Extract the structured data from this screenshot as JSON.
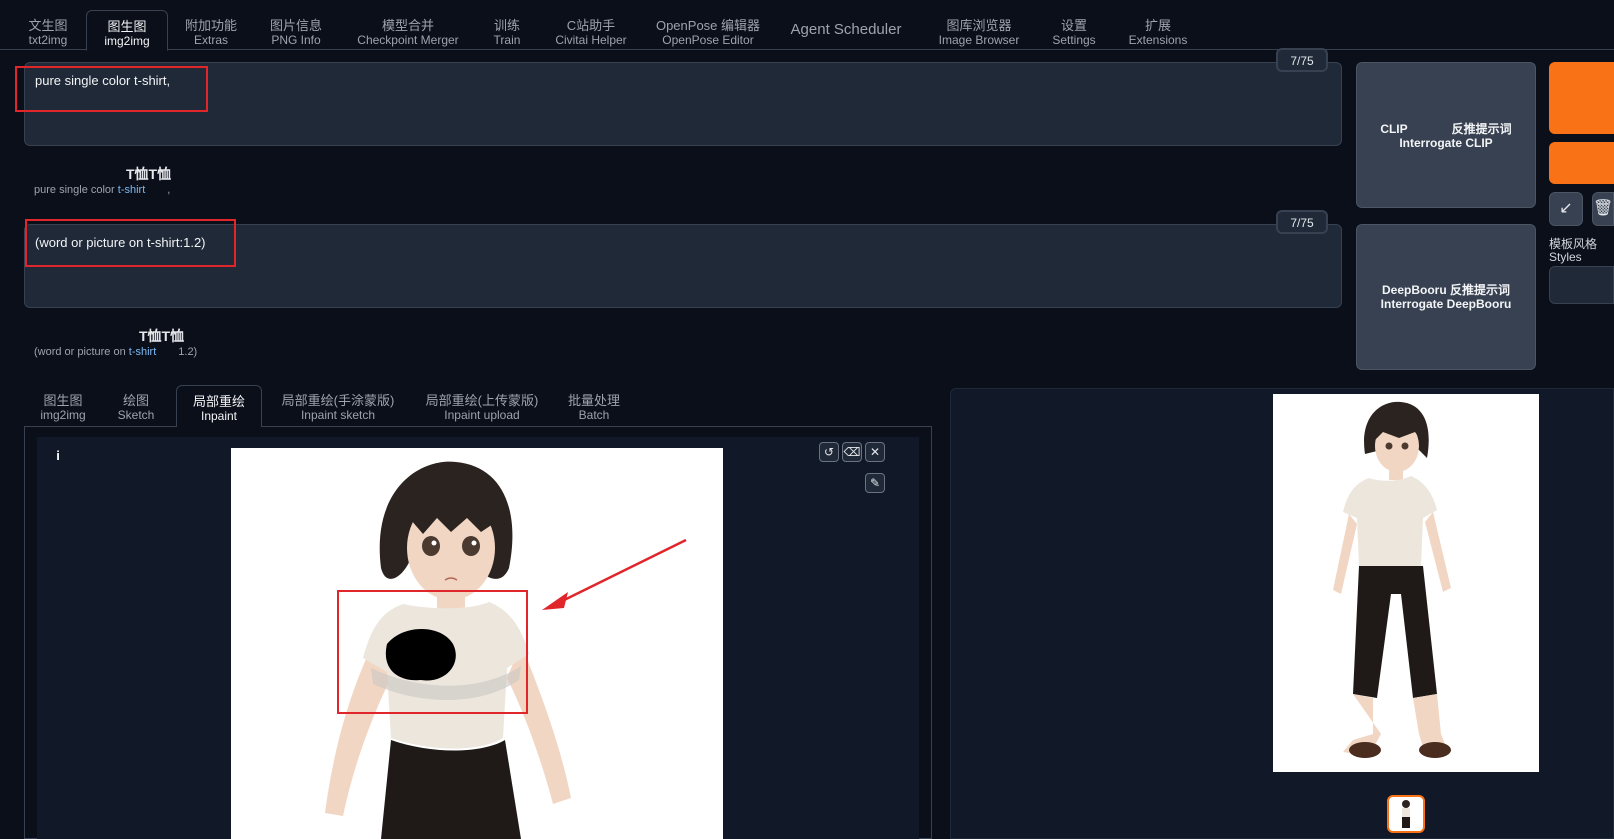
{
  "top_tabs": [
    {
      "zh": "文生图",
      "en": "txt2img"
    },
    {
      "zh": "图生图",
      "en": "img2img"
    },
    {
      "zh": "附加功能",
      "en": "Extras"
    },
    {
      "zh": "图片信息",
      "en": "PNG Info"
    },
    {
      "zh": "模型合并",
      "en": "Checkpoint Merger"
    },
    {
      "zh": "训练",
      "en": "Train"
    },
    {
      "zh": "C站助手",
      "en": "Civitai Helper"
    },
    {
      "zh": "OpenPose 编辑器",
      "en": "OpenPose Editor"
    },
    {
      "label": "Agent Scheduler"
    },
    {
      "zh": "图库浏览器",
      "en": "Image Browser"
    },
    {
      "zh": "设置",
      "en": "Settings"
    },
    {
      "zh": "扩展",
      "en": "Extensions"
    }
  ],
  "prompt": {
    "text": "pure single color t-shirt,",
    "counter": "7/75",
    "translation_title": "T恤T恤",
    "translation_pre": "pure single color ",
    "translation_hl": "t-shirt",
    "translation_post": ","
  },
  "negative_prompt": {
    "text": "(word or picture on t-shirt:1.2)",
    "counter": "7/75",
    "translation_title": "T恤T恤",
    "translation_pre": "(word or picture on ",
    "translation_hl": "t-shirt",
    "translation_post": "1.2)"
  },
  "interrogate": {
    "clip_zh_a": "CLIP",
    "clip_zh_b": "反推提示词",
    "clip_en": "Interrogate CLIP",
    "deepbooru_zh": "DeepBooru 反推提示词",
    "deepbooru_en": "Interrogate DeepBooru"
  },
  "styles": {
    "zh": "模板风格",
    "en": "Styles"
  },
  "sub_tabs": [
    {
      "zh": "图生图",
      "en": "img2img"
    },
    {
      "zh": "绘图",
      "en": "Sketch"
    },
    {
      "zh": "局部重绘",
      "en": "Inpaint"
    },
    {
      "zh": "局部重绘(手涂蒙版)",
      "en": "Inpaint sketch"
    },
    {
      "zh": "局部重绘(上传蒙版)",
      "en": "Inpaint upload"
    },
    {
      "zh": "批量处理",
      "en": "Batch"
    }
  ],
  "canvas": {
    "info": "i"
  },
  "colors": {
    "accent": "#f97316",
    "annotation": "#e0262b",
    "background": "#0b0f19"
  }
}
